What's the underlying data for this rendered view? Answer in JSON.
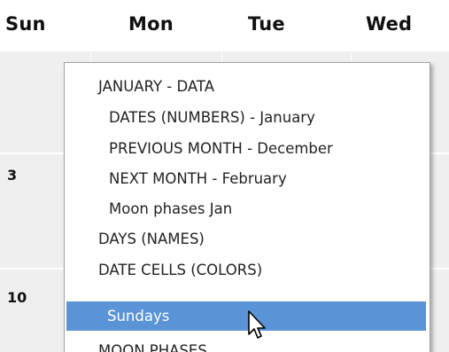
{
  "calendar": {
    "day_headers": [
      "Sun",
      "Mon",
      "Tue",
      "Wed"
    ],
    "row_dates": [
      "3",
      "10"
    ]
  },
  "context_menu": {
    "items": [
      {
        "label": "JANUARY - DATA",
        "level": 1
      },
      {
        "label": "DATES (NUMBERS) - January",
        "level": 2
      },
      {
        "label": "PREVIOUS MONTH - December",
        "level": 2
      },
      {
        "label": "NEXT MONTH - February",
        "level": 2
      },
      {
        "label": "Moon phases Jan",
        "level": 2
      },
      {
        "label": "DAYS (NAMES)",
        "level": 1
      },
      {
        "label": "DATE CELLS (COLORS)",
        "level": 1
      },
      {
        "label": "Sundays",
        "level": 2,
        "highlighted": true
      },
      {
        "label": "MOON PHASES",
        "level": 1
      }
    ]
  },
  "colors": {
    "highlight": "#5b94d6",
    "grid_background": "#efefef",
    "menu_border": "#a0a0a0"
  },
  "cursor": {
    "icon": "arrow-pointer-icon"
  }
}
